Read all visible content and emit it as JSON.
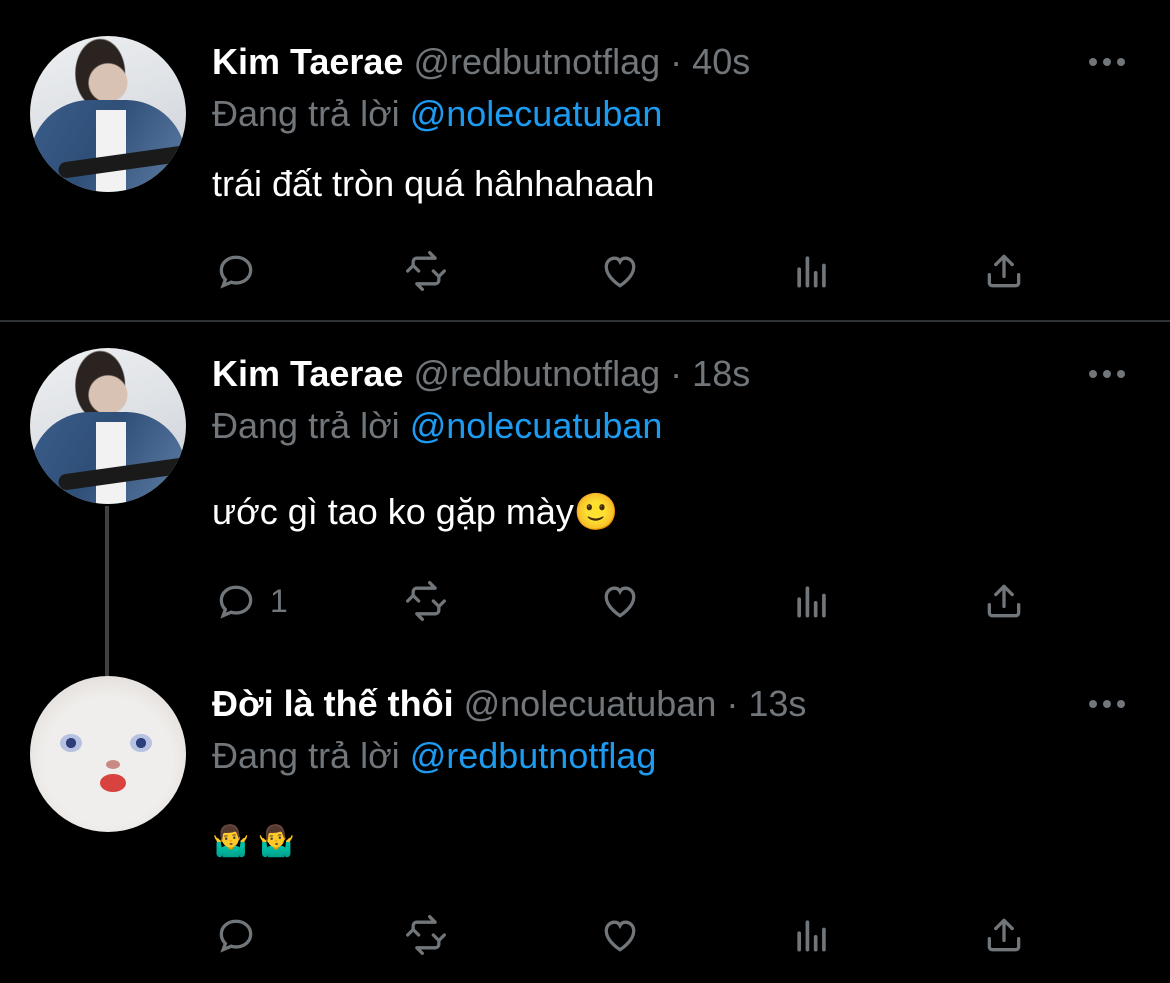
{
  "tweets": [
    {
      "name": "Kim Taerae",
      "handle": "@redbutnotflag",
      "sep": " · ",
      "time": "40s",
      "reply_prefix": "Đang trả lời ",
      "reply_to": "@nolecuatuban",
      "text": "trái đất tròn quá hâhhahaah",
      "reply_count": ""
    },
    {
      "name": "Kim Taerae",
      "handle": "@redbutnotflag",
      "sep": " · ",
      "time": "18s",
      "reply_prefix": "Đang trả lời ",
      "reply_to": "@nolecuatuban",
      "text": "ước gì tao ko gặp mày🙂",
      "reply_count": "1"
    },
    {
      "name": "Đời là thế thôi",
      "handle": "@nolecuatuban",
      "sep": " · ",
      "time": "13s",
      "reply_prefix": "Đang trả lời ",
      "reply_to": "@redbutnotflag",
      "text": "🤷‍♂️ 🤷‍♂️",
      "reply_count": ""
    }
  ],
  "icons": [
    "reply-icon",
    "retweet-icon",
    "like-icon",
    "analytics-icon",
    "share-icon",
    "more-icon"
  ],
  "colors": {
    "background": "#000000",
    "secondary": "#71767b",
    "link": "#1d9bf0",
    "divider": "#2f3336"
  }
}
